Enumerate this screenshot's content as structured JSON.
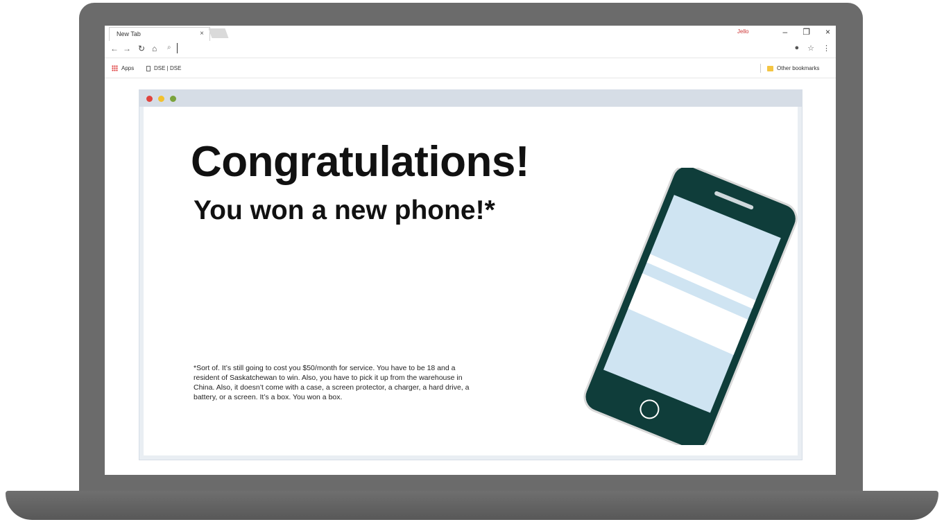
{
  "browser": {
    "tab_title": "New Tab",
    "tab_close": "×",
    "window_controls": [
      "–",
      "❐",
      "×"
    ],
    "profile_label": "Jello",
    "omnibox_value": "",
    "bookmarks": [
      {
        "label": "Apps",
        "icon": "apps-grid-icon"
      },
      {
        "label": "DSE | DSE",
        "icon": "page-icon"
      }
    ],
    "other_bookmarks": "Other bookmarks"
  },
  "page": {
    "headline": "Congratulations!",
    "subheadline": "You won a new phone!*",
    "fine_print": "*Sort of. It’s still going to cost you $50/month for service. You have to be 18 and a resident of Saskatchewan to win. Also, you have to pick it up from the warehouse in China. Also, it doesn’t come with a case, a screen protector, a charger, a hard drive, a battery, or a screen. It’s a box. You won a box.",
    "dots": [
      "#e0443e",
      "#f2c12e",
      "#7aa33c"
    ],
    "phone_colors": {
      "body": "#0f3d3a",
      "screen": "#cfe4f2",
      "stripe": "#ffffff"
    }
  }
}
